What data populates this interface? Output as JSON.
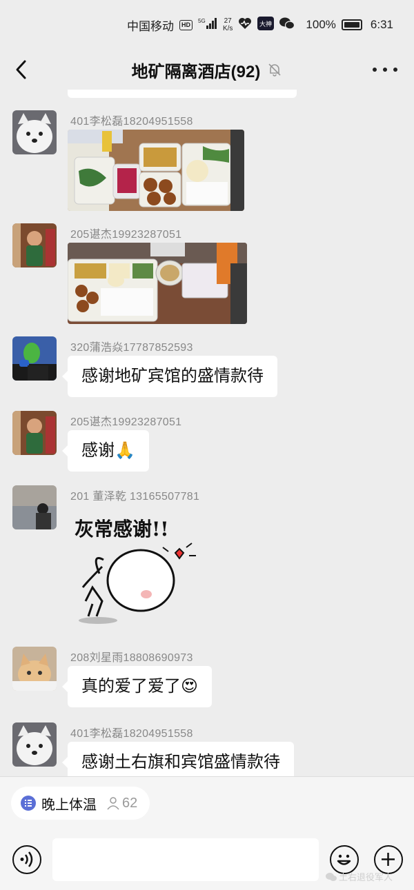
{
  "status_bar": {
    "carrier": "中国移动",
    "hd_badge": "HD",
    "network": "5G",
    "net_speed_value": "27",
    "net_speed_unit": "K/s",
    "app_badge": "大神",
    "battery_percent": "100%",
    "time": "6:31"
  },
  "nav": {
    "title": "地矿隔离酒店(92)"
  },
  "messages": [
    {
      "sender": "401李松磊18204951558",
      "type": "image",
      "avatar_icon": "white-dog-avatar"
    },
    {
      "sender": "205谌杰19923287051",
      "type": "image",
      "avatar_icon": "kid-avatar"
    },
    {
      "sender": "320蒲浩焱17787852593",
      "type": "text",
      "text": "感谢地矿宾馆的盛情款待",
      "avatar_icon": "green-mask-avatar"
    },
    {
      "sender": "205谌杰19923287051",
      "type": "text",
      "text": "感谢",
      "emoji": "🙏",
      "avatar_icon": "kid-avatar"
    },
    {
      "sender": "201 董泽乾 13165507781",
      "type": "sticker",
      "sticker_text": "灰常感谢!!",
      "avatar_icon": "seaside-person-avatar"
    },
    {
      "sender": "208刘星雨18808690973",
      "type": "text",
      "text": "真的爱了爱了",
      "emoji": "😍",
      "avatar_icon": "cat-avatar"
    },
    {
      "sender": "401李松磊18204951558",
      "type": "text",
      "text": "感谢土右旗和宾馆盛情款待",
      "avatar_icon": "white-dog-avatar"
    }
  ],
  "group_notice": {
    "label": "晚上体温",
    "count": "62",
    "icon": "list-icon"
  },
  "input_bar": {
    "voice_icon": "voice-icon",
    "emoji_icon": "smile-icon",
    "plus_icon": "plus-icon"
  },
  "watermark": "土右退役军人",
  "colors": {
    "background": "#ededed",
    "bubble": "#ffffff",
    "sender_text": "#888888",
    "notice_icon": "#5b6fd6"
  }
}
